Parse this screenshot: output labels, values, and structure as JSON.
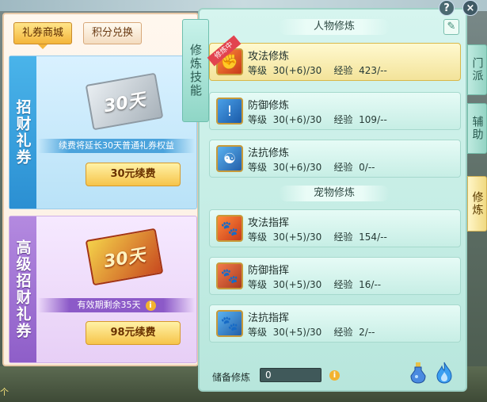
{
  "shop": {
    "tabs": [
      {
        "label": "礼券商城",
        "active": true
      },
      {
        "label": "积分兑换",
        "active": false
      }
    ],
    "cards": [
      {
        "side_label": "招财礼券",
        "ticket_text": "30天",
        "caption": "续费将延长30天普通礼券权益",
        "button": "30元续费"
      },
      {
        "side_label": "高级招财礼券",
        "ticket_text": "30天",
        "caption": "有效期剩余35天",
        "button": "98元续费"
      }
    ]
  },
  "cultivation": {
    "side_tab": "修炼技能",
    "sections": [
      {
        "title": "人物修炼",
        "skills": [
          {
            "name": "攻法修炼",
            "level": "等级  30(+6)/30",
            "exp": "经验  423/--",
            "selected": true,
            "badge": "修炼中"
          },
          {
            "name": "防御修炼",
            "level": "等级  30(+6)/30",
            "exp": "经验  109/--",
            "selected": false
          },
          {
            "name": "法抗修炼",
            "level": "等级  30(+6)/30",
            "exp": "经验  0/--",
            "selected": false
          }
        ]
      },
      {
        "title": "宠物修炼",
        "skills": [
          {
            "name": "攻法指挥",
            "level": "等级  30(+5)/30",
            "exp": "经验  154/--",
            "selected": false
          },
          {
            "name": "防御指挥",
            "level": "等级  30(+5)/30",
            "exp": "经验  16/--",
            "selected": false
          },
          {
            "name": "法抗指挥",
            "level": "等级  30(+5)/30",
            "exp": "经验  2/--",
            "selected": false
          }
        ]
      }
    ],
    "reserve": {
      "label": "储备修炼",
      "value": "0"
    }
  },
  "right_tabs": [
    {
      "label": "门派",
      "active": false
    },
    {
      "label": "辅助",
      "active": false
    },
    {
      "label": "修炼",
      "active": true
    }
  ],
  "window_controls": {
    "help": "?",
    "close": "×"
  },
  "scenery_text": "个",
  "colors": {
    "accent_gold": "#f6c44a",
    "panel_mint": "#c7eee5",
    "selected_row": "#f3e39a",
    "badge_red": "#e2434f"
  }
}
